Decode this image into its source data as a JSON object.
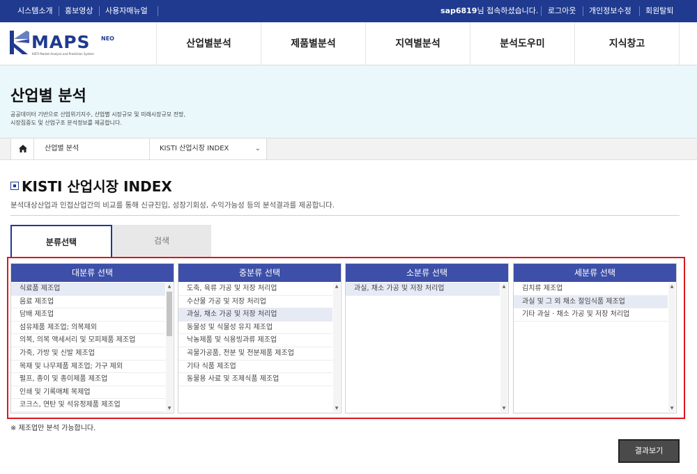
{
  "topbar": {
    "left_links": [
      "시스템소개",
      "홍보영상",
      "사용자매뉴얼"
    ],
    "user_id": "sap6819",
    "user_suffix": "님 접속하셨습니다.",
    "right_links": [
      "로그아웃",
      "개인정보수정",
      "회원탈퇴"
    ]
  },
  "logo": {
    "text": "MAPS",
    "neo": "NEO",
    "sub": "KISTI Market Analysis and Prediction System"
  },
  "gnb": [
    "산업별분석",
    "제품별분석",
    "지역별분석",
    "분석도우미",
    "지식창고"
  ],
  "hero": {
    "title": "산업별 분석",
    "desc_line1": "공공데이터 기반으로 산업위기지수, 산업별 시장규모 및 미래시장규모 전망,",
    "desc_line2": "시장집중도 및 산업구조 분석정보를 제공합니다."
  },
  "breadcrumb": {
    "level1": "산업별 분석",
    "level2": "KISTI 산업시장 INDEX"
  },
  "page": {
    "title": "KISTI 산업시장 INDEX",
    "desc": "분석대상산업과 인접산업간의 비교를 통해 신규진입, 성장기회성, 수익가능성 등의 분석결과를 제공합니다."
  },
  "tabs": {
    "active": "분류선택",
    "inactive": "검색"
  },
  "columns": [
    {
      "header": "대분류 선택",
      "items": [
        "식료품 제조업",
        "음료 제조업",
        "담배 제조업",
        "섬유제품 제조업; 의복제외",
        "의복, 의복 액세서리 및 모피제품 제조업",
        "가죽, 가방 및 신발 제조업",
        "목재 및 나무제품 제조업; 가구 제외",
        "펄프, 종이 및 종이제품 제조업",
        "인쇄 및 기록매체 복제업",
        "코크스, 연탄 및 석유정제품 제조업"
      ],
      "selected": 0,
      "has_scroll_thumb": true
    },
    {
      "header": "중분류 선택",
      "items": [
        "도축, 육류 가공 및 저장 처리업",
        "수산물 가공 및 저장 처리업",
        "과실, 채소 가공 및 저장 처리업",
        "동물성 및 식물성 유지 제조업",
        "낙농제품 및 식용빙과류 제조업",
        "곡물가공품, 전분 및 전분제품 제조업",
        "기타 식품 제조업",
        "동물용 사료 및 조제식품 제조업"
      ],
      "selected": 2,
      "has_scroll_thumb": false
    },
    {
      "header": "소분류 선택",
      "items": [
        "과실, 채소 가공 및 저장 처리업"
      ],
      "selected": 0,
      "has_scroll_thumb": false
    },
    {
      "header": "세분류 선택",
      "items": [
        "김치류 제조업",
        "과실 및 그 외 채소 절임식품 제조업",
        "기타 과실 · 채소 가공 및 저장 처리업"
      ],
      "selected": 1,
      "has_scroll_thumb": false
    }
  ],
  "note": "※ 제조업만 분석 가능합니다.",
  "result_button": "결과보기",
  "colors": {
    "navy": "#1f3a8f",
    "column_header": "#3d4fa8",
    "highlight_border": "#d9171c"
  }
}
